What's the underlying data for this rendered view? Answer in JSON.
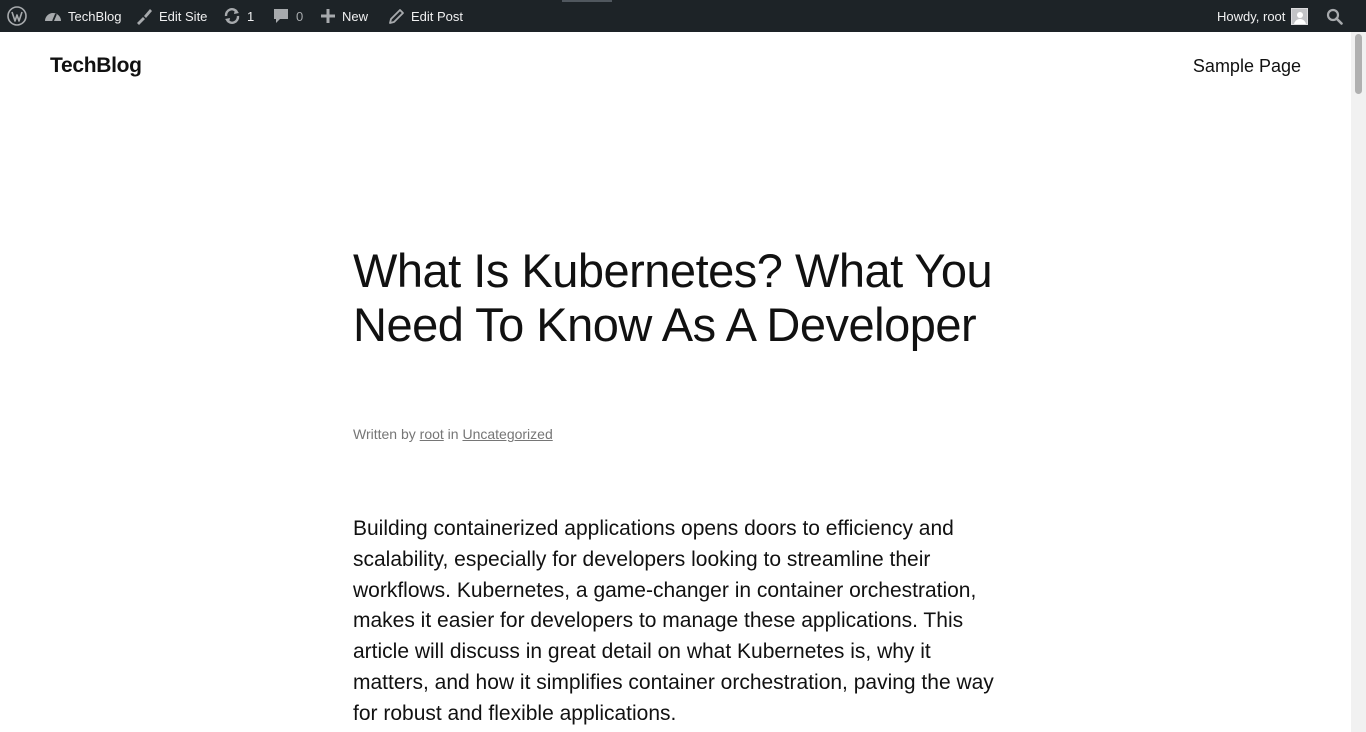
{
  "adminbar": {
    "site_name": "TechBlog",
    "edit_site": "Edit Site",
    "updates_count": "1",
    "comments_count": "0",
    "new_label": "New",
    "edit_post": "Edit Post",
    "howdy": "Howdy, root",
    "icons": {
      "wp": "wordpress-logo-icon",
      "dashboard": "dashboard-icon",
      "edit_site": "brush-icon",
      "updates": "refresh-icon",
      "comments": "comment-icon",
      "new": "plus-icon",
      "edit": "pencil-icon",
      "search": "search-icon"
    },
    "background_color": "#1d2327"
  },
  "header": {
    "site_title": "TechBlog",
    "nav": [
      "Sample Page"
    ]
  },
  "post": {
    "title": "What Is Kubernetes? What You Need To Know As A Developer",
    "meta": {
      "written_by": "Written by",
      "author": "root",
      "in": "in",
      "category": "Uncategorized"
    },
    "intro": "Building containerized applications opens doors to efficiency and scalability, especially for developers looking to streamline their workflows. Kubernetes, a game-changer in container orchestration, makes it easier for developers to manage these applications. This article will discuss in great detail on what Kubernetes is, why it matters, and how it simplifies container orchestration, paving the way for robust and flexible applications."
  }
}
